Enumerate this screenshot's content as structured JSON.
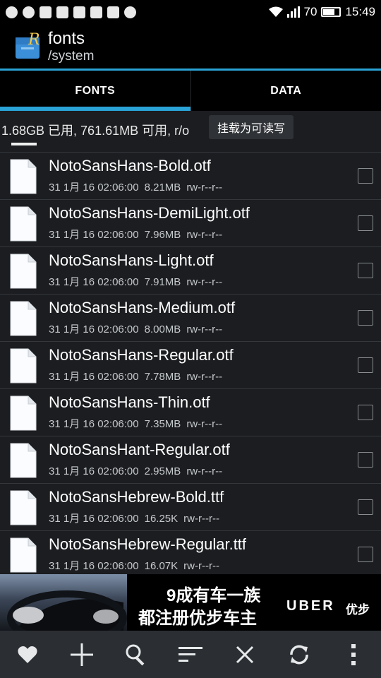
{
  "status_bar": {
    "time": "15:49",
    "battery": "70",
    "left_icons": [
      "q-app-icon",
      "weibo-icon",
      "diy-icon",
      "apps-grid-icon",
      "image-icon",
      "lemo-icon",
      "flag-icon",
      "more-dots-icon"
    ],
    "right_icons": [
      "wifi-icon",
      "signal-icon",
      "battery-icon"
    ]
  },
  "app_bar": {
    "title": "fonts",
    "path": "/system"
  },
  "tabs": [
    {
      "label": "FONTS",
      "active": true
    },
    {
      "label": "DATA",
      "active": false
    }
  ],
  "storage": {
    "info": "1.68GB 已用, 761.61MB 可用, r/o",
    "mount_button": "挂载为可读写"
  },
  "files": [
    {
      "name": "NotoSansHans-Bold.otf",
      "date": "31 1月 16 02:06:00",
      "size": "8.21MB",
      "perm": "rw-r--r--"
    },
    {
      "name": "NotoSansHans-DemiLight.otf",
      "date": "31 1月 16 02:06:00",
      "size": "7.96MB",
      "perm": "rw-r--r--"
    },
    {
      "name": "NotoSansHans-Light.otf",
      "date": "31 1月 16 02:06:00",
      "size": "7.91MB",
      "perm": "rw-r--r--"
    },
    {
      "name": "NotoSansHans-Medium.otf",
      "date": "31 1月 16 02:06:00",
      "size": "8.00MB",
      "perm": "rw-r--r--"
    },
    {
      "name": "NotoSansHans-Regular.otf",
      "date": "31 1月 16 02:06:00",
      "size": "7.78MB",
      "perm": "rw-r--r--"
    },
    {
      "name": "NotoSansHans-Thin.otf",
      "date": "31 1月 16 02:06:00",
      "size": "7.35MB",
      "perm": "rw-r--r--"
    },
    {
      "name": "NotoSansHant-Regular.otf",
      "date": "31 1月 16 02:06:00",
      "size": "2.95MB",
      "perm": "rw-r--r--"
    },
    {
      "name": "NotoSansHebrew-Bold.ttf",
      "date": "31 1月 16 02:06:00",
      "size": "16.25K",
      "perm": "rw-r--r--"
    },
    {
      "name": "NotoSansHebrew-Regular.ttf",
      "date": "31 1月 16 02:06:00",
      "size": "16.07K",
      "perm": "rw-r--r--"
    }
  ],
  "ad": {
    "line1": "9成有车一族",
    "line2": "都注册优步车主",
    "brand": "UBER",
    "brand_cn": "优步"
  },
  "bottom_bar": [
    "favorite-icon",
    "add-icon",
    "search-icon",
    "sort-icon",
    "close-icon",
    "refresh-icon",
    "overflow-menu-icon"
  ],
  "colors": {
    "accent": "#2aa3d6",
    "background": "#1b1d20",
    "bar": "#000000",
    "bottom_bar": "#2b2e32"
  }
}
